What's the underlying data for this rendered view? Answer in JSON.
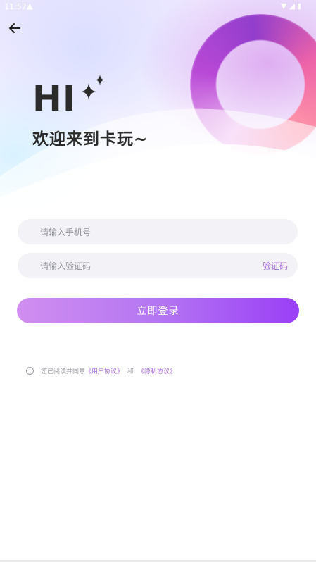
{
  "status_bar": {
    "time": "11:57",
    "notification_icon": "android-icon",
    "right_icons": [
      "wifi-icon",
      "signal-icon",
      "battery-icon"
    ]
  },
  "header": {
    "back_icon": "arrow-left-icon",
    "hi": "HI",
    "sparkle_icon": "sparkle-icon",
    "welcome": "欢迎来到卡玩~"
  },
  "form": {
    "phone_placeholder": "请输入手机号",
    "phone_value": "",
    "code_placeholder": "请输入验证码",
    "code_value": "",
    "get_code_label": "验证码",
    "login_label": "立即登录"
  },
  "agreement": {
    "prefix": "您已阅读并同意",
    "user_agreement": "《用户协议》",
    "and": "和",
    "privacy_policy": "《隐私协议》",
    "checked": false
  },
  "colors": {
    "accent": "#a667d8",
    "button_start": "#d08ef0",
    "button_end": "#9a3ff6",
    "input_bg": "#f3f3f7",
    "title_text": "#2b2b2b"
  }
}
